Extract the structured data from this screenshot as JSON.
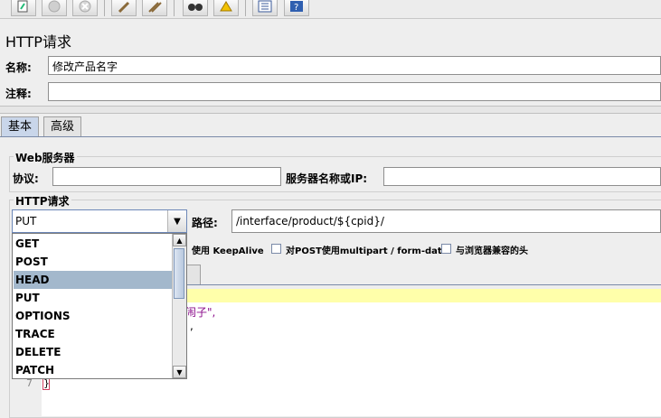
{
  "toolbar": {
    "buttons": [
      "clear-icon",
      "stop-icon",
      "shutdown-icon",
      "broom-icon",
      "broom-all-icon",
      "binoculars-icon",
      "reset-search-icon",
      "function-helper-icon",
      "help-icon"
    ]
  },
  "page_title": "HTTP请求",
  "name": {
    "label": "名称:",
    "value": "修改产品名字"
  },
  "comment": {
    "label": "注释:",
    "value": ""
  },
  "tabs": [
    {
      "label": "基本",
      "selected": true
    },
    {
      "label": "高级",
      "selected": false
    }
  ],
  "web_server": {
    "title": "Web服务器",
    "protocol_label": "协议:",
    "protocol_value": "",
    "server_label": "服务器名称或IP:",
    "server_value": ""
  },
  "http_request": {
    "title": "HTTP请求",
    "method_selected": "PUT",
    "path_label": "路径:",
    "path_value": "/interface/product/${cpid}/",
    "methods": [
      "GET",
      "POST",
      "HEAD",
      "PUT",
      "OPTIONS",
      "TRACE",
      "DELETE",
      "PATCH"
    ],
    "highlighted_method": "HEAD"
  },
  "options": {
    "keepalive_label": "使用 KeepAlive",
    "multipart_label": "对POST使用multipart / form-data",
    "browser_headers_label": "与浏览器兼容的头"
  },
  "body": {
    "line1": "闹子\",",
    "line2": ",",
    "line5_num": "7",
    "line5_text": "}"
  },
  "colors": {
    "accent": "#c9d6ea",
    "highlight": "#a3b8cc",
    "yellow_line": "#ffffaa"
  }
}
